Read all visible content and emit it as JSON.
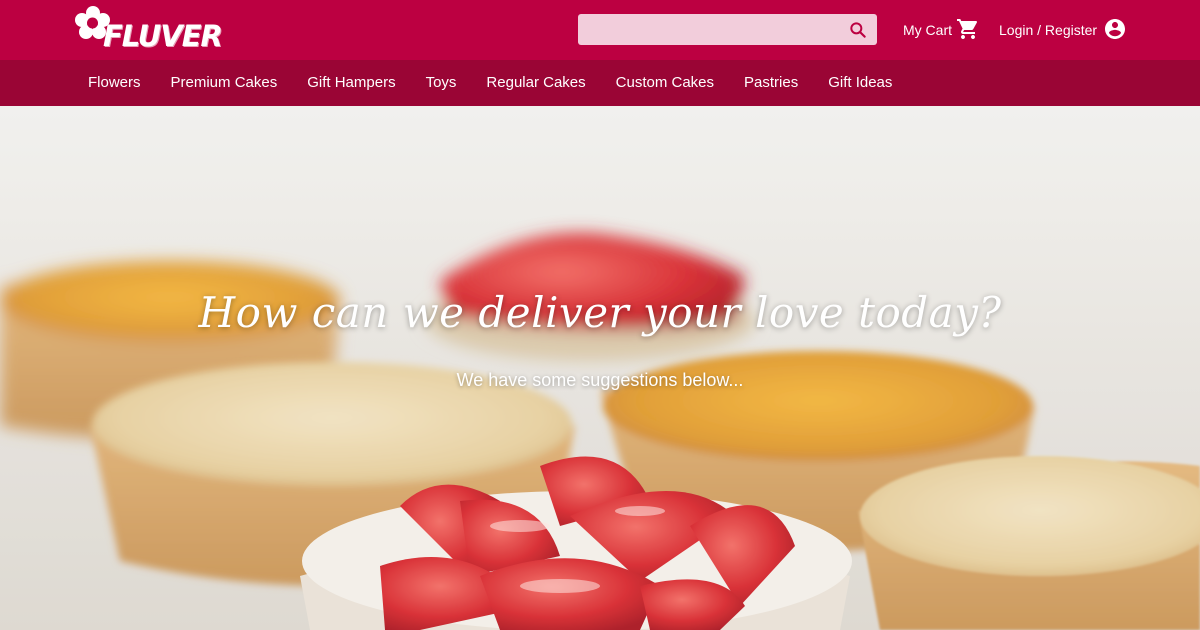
{
  "brand": {
    "logo_text": "FLUVER",
    "logo_icon": "flower-icon",
    "primary_color": "#bc0041",
    "nav_color": "#9a0535",
    "search_bg_color": "#f2cddb"
  },
  "header": {
    "search": {
      "placeholder": "",
      "value": "",
      "icon": "search-icon"
    },
    "cart": {
      "label": "My Cart",
      "icon": "shopping-cart-icon"
    },
    "account": {
      "label": "Login / Register",
      "icon": "account-circle-icon"
    }
  },
  "nav": {
    "items": [
      {
        "label": "Flowers"
      },
      {
        "label": "Premium Cakes"
      },
      {
        "label": "Gift Hampers"
      },
      {
        "label": "Toys"
      },
      {
        "label": "Regular Cakes"
      },
      {
        "label": "Custom Cakes"
      },
      {
        "label": "Pastries"
      },
      {
        "label": "Gift Ideas"
      }
    ]
  },
  "hero": {
    "title": "How can we deliver your love today?",
    "subtitle": "We have some suggestions below...",
    "image_subject": "strawberry tarts and custard pies"
  }
}
